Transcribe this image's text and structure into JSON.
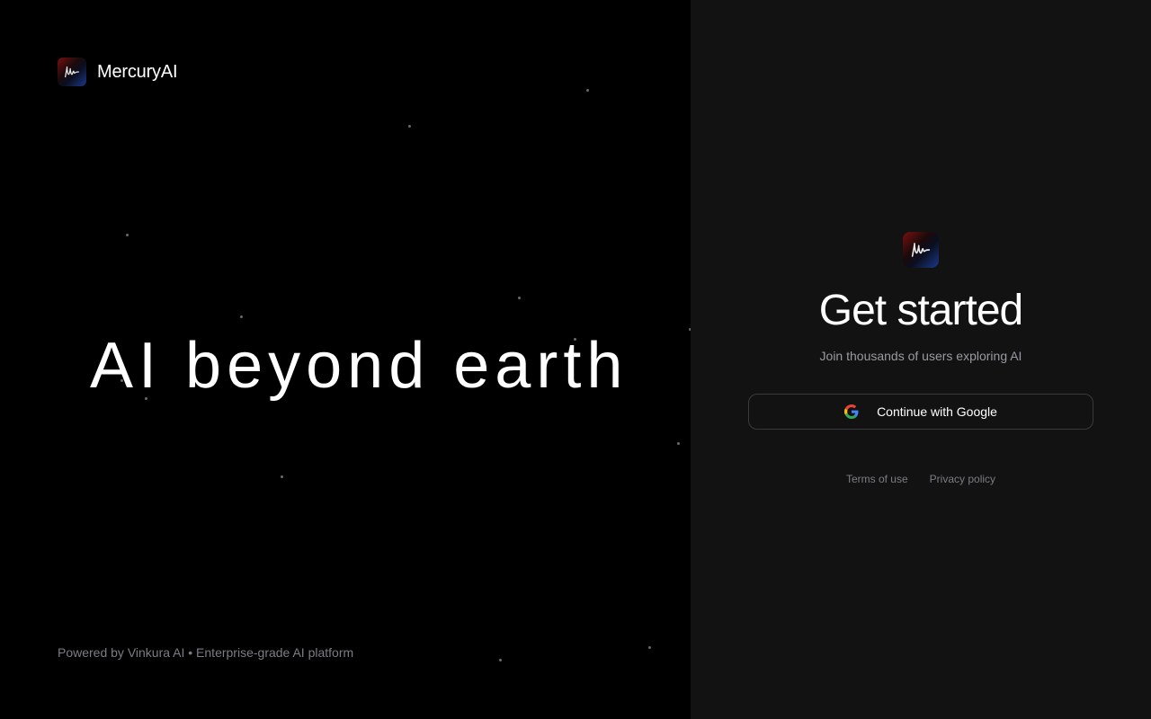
{
  "brand": {
    "name": "MercuryAI",
    "logo_icon": "mercury-signature-logo"
  },
  "hero": {
    "headline": "AI beyond earth"
  },
  "footer": {
    "note": "Powered by Vinkura AI • Enterprise-grade AI platform"
  },
  "auth": {
    "title": "Get started",
    "subtitle": "Join thousands of users exploring AI",
    "google_button_label": "Continue with Google",
    "google_icon": "google-g-icon",
    "links": {
      "terms": "Terms of use",
      "privacy": "Privacy policy"
    }
  },
  "colors": {
    "left_background": "#000000",
    "right_background": "#121212",
    "muted_text": "#7c7c84",
    "button_border": "#3a3a3e"
  }
}
